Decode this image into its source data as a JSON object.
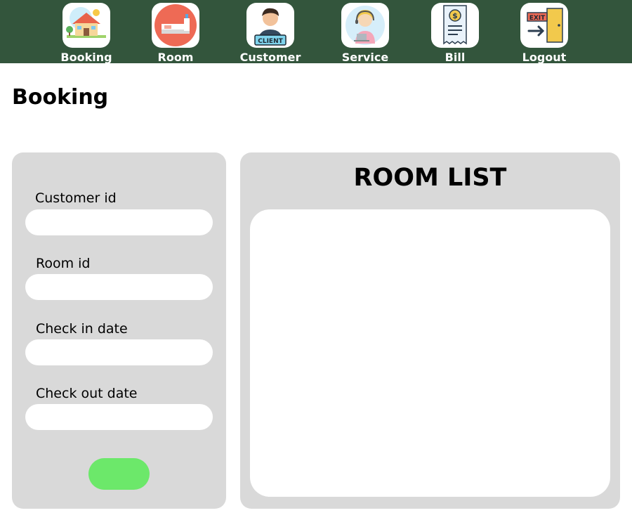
{
  "nav": {
    "items": [
      {
        "label": "Booking",
        "icon": "house-icon"
      },
      {
        "label": "Room",
        "icon": "bed-icon"
      },
      {
        "label": "Customer",
        "icon": "client-icon"
      },
      {
        "label": "Service",
        "icon": "support-agent-icon"
      },
      {
        "label": "Bill",
        "icon": "receipt-icon"
      },
      {
        "label": "Logout",
        "icon": "exit-door-icon"
      }
    ]
  },
  "page": {
    "title": "Booking"
  },
  "form": {
    "customer_id_label": "Customer id",
    "customer_id_value": "",
    "room_id_label": "Room id",
    "room_id_value": "",
    "check_in_label": "Check in date",
    "check_in_value": "",
    "check_out_label": "Check out date",
    "check_out_value": "",
    "submit_label": ""
  },
  "room_list": {
    "title": "ROOM LIST",
    "rooms": []
  },
  "colors": {
    "topbar": "#33553c",
    "panel": "#d9d9d9",
    "submit": "#6ce86a"
  }
}
